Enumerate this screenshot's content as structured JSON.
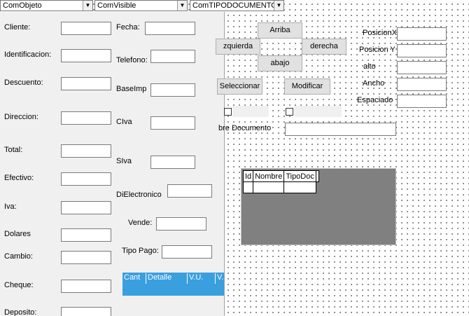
{
  "combos": {
    "objeto": "ComObjeto",
    "visible": "ComVisible",
    "tipodoc": "ComTIPODOCUMENTO"
  },
  "form": {
    "cliente": "Cliente:",
    "identificacion": "Identificacion:",
    "descuento": "Descuento:",
    "direccion": "Direccion:",
    "total": "Total:",
    "efectivo": "Efectivo:",
    "iva": "Iva:",
    "dolares": "Dolares",
    "cambio": "Cambio:",
    "cheque": "Cheque:",
    "deposito": "Deposito:",
    "fecha": "Fecha:",
    "telefono": "Telefono:",
    "baseimp": "BaseImp",
    "civa": "CIva",
    "siva": "SIva",
    "dielectronico": "DiElectronico",
    "vende": "Vende:",
    "tipopago": "Tipo Pago:"
  },
  "positioning": {
    "arriba": "Arriba",
    "izquierda": "zquierda",
    "derecha": "derecha",
    "abajo": "abajo",
    "seleccionar": "Seleccionar",
    "modificar": "Modificar",
    "nombre_documento": "bre Documento",
    "posicionx": "PosicionX",
    "posiciony": "Posicion Y",
    "alto": "alto",
    "ancho": "Ancho",
    "espaciado": "Espaciado"
  },
  "doc_grid": {
    "columns": [
      "Id",
      "Nombre",
      "TipoDoc"
    ]
  },
  "detail_grid": {
    "columns": [
      "Cant",
      "Detalle",
      "V.U.",
      "V."
    ]
  },
  "colors": {
    "grid_header": "#3a9fdf",
    "panel_bg": "#f0f0f0",
    "grid_bg": "#808080"
  }
}
